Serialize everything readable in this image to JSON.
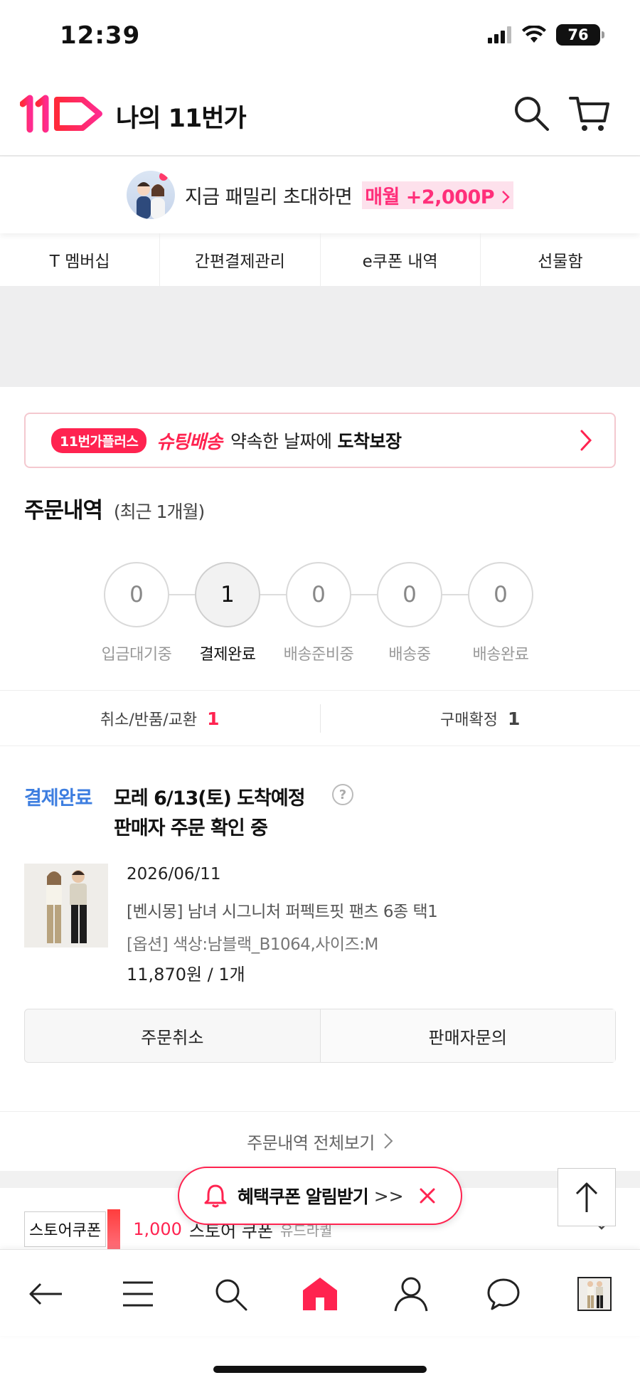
{
  "status_bar": {
    "time": "12:39",
    "battery": "76"
  },
  "header": {
    "title": "나의 11번가"
  },
  "promo": {
    "text": "지금 패밀리 초대하면",
    "highlight": "매월 +2,000P"
  },
  "quick_menu": [
    "T 멤버십",
    "간편결제관리",
    "e쿠폰 내역",
    "선물함"
  ],
  "shipping_banner": {
    "badge": "11번가플러스",
    "brand": "슈팅배송",
    "text": "약속한 날짜에",
    "bold": "도착보장"
  },
  "orders": {
    "title": "주문내역",
    "subtitle": "(최근 1개월)",
    "steps": [
      {
        "count": "0",
        "label": "입금대기중"
      },
      {
        "count": "1",
        "label": "결제완료"
      },
      {
        "count": "0",
        "label": "배송준비중"
      },
      {
        "count": "0",
        "label": "배송중"
      },
      {
        "count": "0",
        "label": "배송완료"
      }
    ],
    "summary": [
      {
        "label": "취소/반품/교환",
        "count": "1"
      },
      {
        "label": "구매확정",
        "count": "1"
      }
    ]
  },
  "order_card": {
    "status": "결제완료",
    "line1": "모레 6/13(토) 도착예정",
    "line2": "판매자 주문 확인 중",
    "help": "?",
    "date": "2026/06/11",
    "product_name": "[벤시몽] 남녀 시그니처 퍼펙트핏 팬츠 6종 택1",
    "option": "[옵션] 색상:남블랙_B1064,사이즈:M",
    "price": "11,870원 / 1개",
    "buttons": {
      "cancel": "주문취소",
      "inquiry": "판매자문의"
    }
  },
  "view_all": "주문내역 전체보기",
  "coupon_strip": {
    "tag": "스토어쿠폰",
    "amount": "1,000",
    "text": "스토어 쿠폰",
    "sub": "유드라퀄"
  },
  "alert": {
    "text": "혜택쿠폰 알림받기",
    "chevron": ">>"
  },
  "colors": {
    "brand": "#ff2350",
    "blue": "#3d7ee0",
    "pink_bg": "#fde1ec"
  },
  "icons": [
    "signal-icon",
    "wifi-icon",
    "search-icon",
    "cart-icon",
    "back-icon",
    "menu-icon",
    "home-icon",
    "user-icon",
    "chat-icon",
    "bell-icon",
    "close-icon",
    "arrow-up-icon"
  ]
}
